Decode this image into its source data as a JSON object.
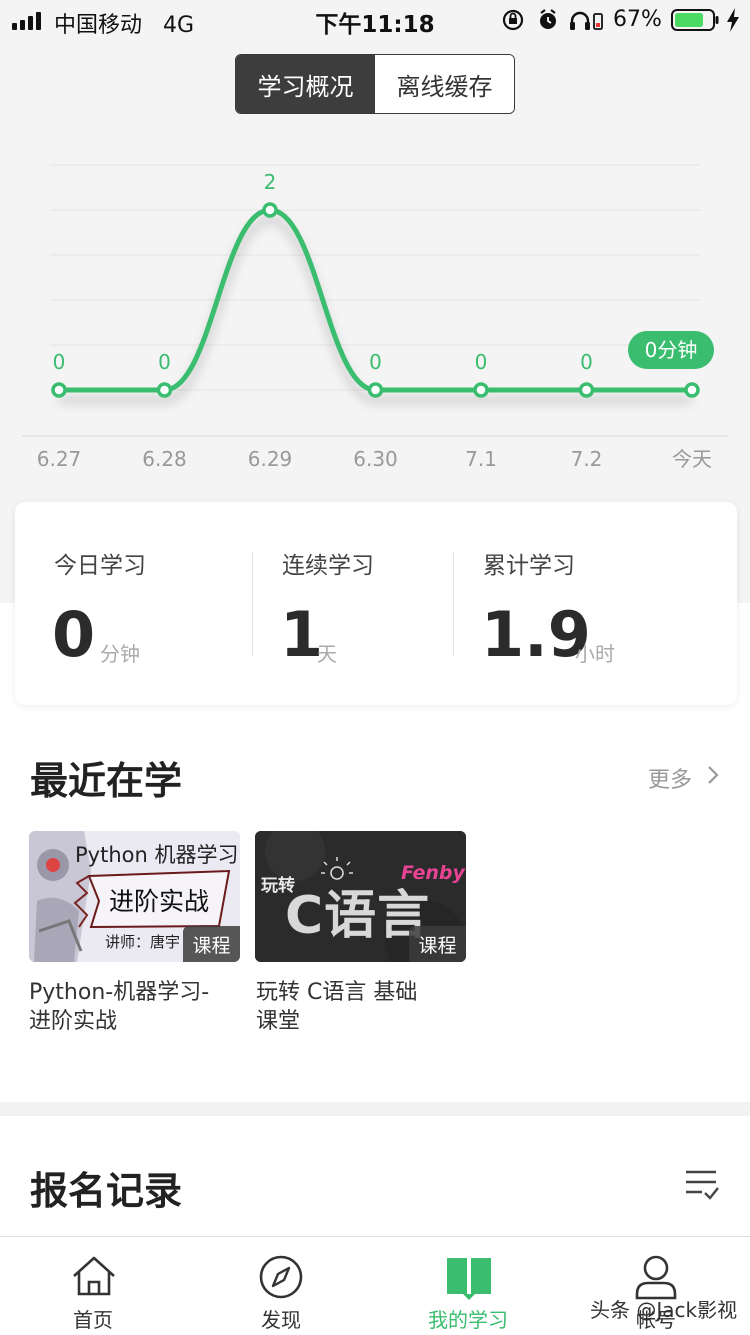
{
  "status_bar": {
    "carrier": "中国移动",
    "network": "4G",
    "time": "下午11:18",
    "battery": "67%"
  },
  "segment": {
    "active": "学习概况",
    "inactive": "离线缓存"
  },
  "chart_data": {
    "type": "line",
    "categories": [
      "6.27",
      "6.28",
      "6.29",
      "6.30",
      "7.1",
      "7.2",
      "今天"
    ],
    "values": [
      0,
      0,
      2,
      0,
      0,
      0,
      0
    ],
    "value_labels": [
      "0",
      "0",
      "2",
      "0",
      "0",
      "0",
      "0分钟"
    ],
    "color": "#3bbd6f",
    "grid": true
  },
  "stats": [
    {
      "label": "今日学习",
      "value": "0",
      "unit": "分钟"
    },
    {
      "label": "连续学习",
      "value": "1",
      "unit": "天"
    },
    {
      "label": "累计学习",
      "value": "1.9",
      "unit": "小时"
    }
  ],
  "recent": {
    "title": "最近在学",
    "more": "更多",
    "courses": [
      {
        "title_line1": "Python-机器学习-",
        "title_line2": "进阶实战",
        "tag": "课程",
        "thumb_heading": "Python 机器学习",
        "thumb_banner": "进阶实战",
        "thumb_lecturer": "讲师：唐宇"
      },
      {
        "title_line1": "玩转 C语言 基础",
        "title_line2": "课堂",
        "tag": "课程",
        "thumb_left": "玩转",
        "thumb_main": "C语言",
        "thumb_brand": "Fenby"
      }
    ]
  },
  "records": {
    "title": "报名记录"
  },
  "tabbar": {
    "items": [
      {
        "label": "首页",
        "icon": "home-icon"
      },
      {
        "label": "发现",
        "icon": "compass-icon"
      },
      {
        "label": "我的学习",
        "icon": "book-icon"
      },
      {
        "label": "帐号",
        "icon": "user-icon"
      }
    ],
    "active_color": "#3bbd6f"
  },
  "watermark": "头条 @Jack影视"
}
